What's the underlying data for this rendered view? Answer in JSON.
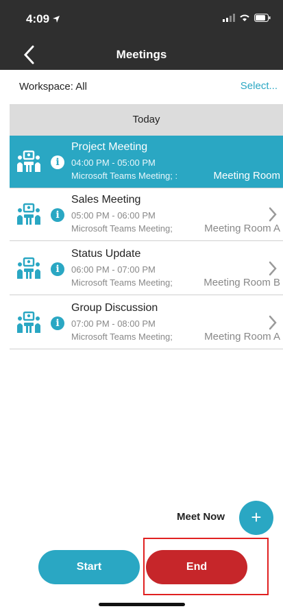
{
  "status_bar": {
    "time": "4:09"
  },
  "nav": {
    "title": "Meetings"
  },
  "workspace": {
    "label": "Workspace: All",
    "select": "Select..."
  },
  "section": {
    "header": "Today"
  },
  "meetings": [
    {
      "title": "Project Meeting",
      "time": "04:00 PM - 05:00 PM",
      "location": "Microsoft Teams Meeting; :",
      "room": "Meeting Room",
      "selected": true
    },
    {
      "title": "Sales Meeting",
      "time": "05:00 PM - 06:00 PM",
      "location": "Microsoft Teams Meeting;",
      "room": "Meeting Room A",
      "selected": false
    },
    {
      "title": "Status Update",
      "time": "06:00 PM - 07:00 PM",
      "location": "Microsoft Teams Meeting;",
      "room": "Meeting Room B",
      "selected": false
    },
    {
      "title": "Group Discussion",
      "time": "07:00 PM - 08:00 PM",
      "location": "Microsoft Teams Meeting;",
      "room": "Meeting Room A",
      "selected": false
    }
  ],
  "info_glyph": "i",
  "meet_now": {
    "label": "Meet Now",
    "icon": "+"
  },
  "actions": {
    "start": "Start",
    "end": "End"
  },
  "colors": {
    "accent": "#2aa7c3",
    "end": "#c6262a",
    "header_bg": "#2f2f2f",
    "highlight": "#e02020"
  }
}
